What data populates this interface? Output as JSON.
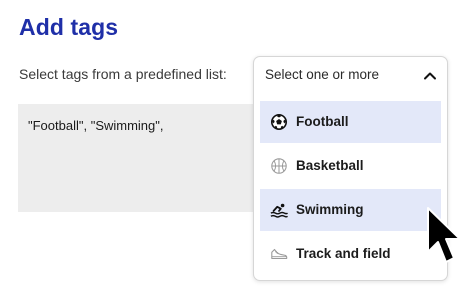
{
  "page": {
    "title": "Add tags",
    "prompt": "Select tags from a predefined list:"
  },
  "tags_field": {
    "value": "\"Football\", \"Swimming\","
  },
  "dropdown": {
    "placeholder": "Select one or more",
    "expanded": true,
    "chevron_icon": "chevron-up-icon",
    "options": [
      {
        "label": "Football",
        "icon": "soccer-ball-icon",
        "selected": true
      },
      {
        "label": "Basketball",
        "icon": "basketball-icon",
        "selected": false
      },
      {
        "label": "Swimming",
        "icon": "swimmer-icon",
        "selected": true
      },
      {
        "label": "Track and field",
        "icon": "sneaker-icon",
        "selected": false
      }
    ]
  },
  "colors": {
    "title": "#1f2fa8",
    "selected_bg": "#e3e8f9",
    "field_bg": "#ededed"
  }
}
